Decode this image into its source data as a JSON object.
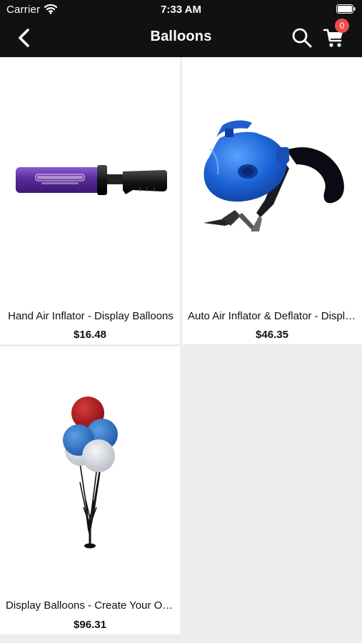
{
  "status_bar": {
    "carrier": "Carrier",
    "time": "7:33 AM"
  },
  "nav": {
    "title": "Balloons",
    "back_icon": "chevron-left-icon",
    "search_icon": "search-icon",
    "cart_icon": "cart-icon",
    "cart_count": "0",
    "badge_color": "#f04a4a",
    "bar_color": "#111111"
  },
  "products": [
    {
      "name": "Hand Air Inflator - Display Balloons",
      "price": "$16.48",
      "image": "hand-pump-image"
    },
    {
      "name": "Auto Air Inflator & Deflator - Display Balloons",
      "price": "$46.35",
      "image": "electric-pump-image"
    },
    {
      "name": "Display Balloons - Create Your Own",
      "price": "$96.31",
      "image": "balloon-bouquet-image"
    }
  ]
}
